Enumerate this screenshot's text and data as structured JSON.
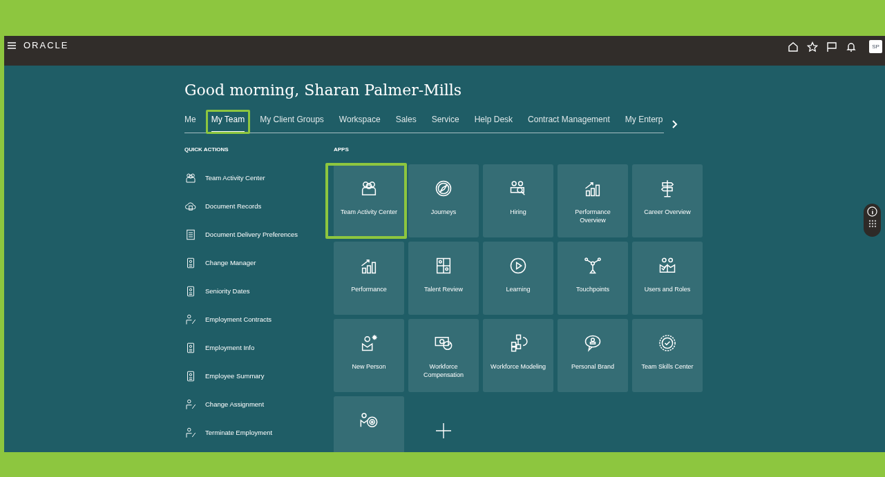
{
  "header": {
    "brand": "ORACLE",
    "avatar": "SP"
  },
  "greeting": "Good morning, Sharan Palmer-Mills",
  "tabs": [
    {
      "label": "Me",
      "selected": false,
      "highlighted": false
    },
    {
      "label": "My Team",
      "selected": true,
      "highlighted": true
    },
    {
      "label": "My Client Groups",
      "selected": false,
      "highlighted": false
    },
    {
      "label": "Workspace",
      "selected": false,
      "highlighted": false
    },
    {
      "label": "Sales",
      "selected": false,
      "highlighted": false
    },
    {
      "label": "Service",
      "selected": false,
      "highlighted": false
    },
    {
      "label": "Help Desk",
      "selected": false,
      "highlighted": false
    },
    {
      "label": "Contract Management",
      "selected": false,
      "highlighted": false
    },
    {
      "label": "My Enterp",
      "selected": false,
      "highlighted": false
    }
  ],
  "quick_actions": {
    "title": "QUICK ACTIONS",
    "items": [
      {
        "label": "Team Activity Center"
      },
      {
        "label": "Document Records"
      },
      {
        "label": "Document Delivery Preferences"
      },
      {
        "label": "Change Manager"
      },
      {
        "label": "Seniority Dates"
      },
      {
        "label": "Employment Contracts"
      },
      {
        "label": "Employment Info"
      },
      {
        "label": "Employee Summary"
      },
      {
        "label": "Change Assignment"
      },
      {
        "label": "Terminate Employment"
      }
    ]
  },
  "apps": {
    "title": "APPS",
    "tiles": [
      {
        "kind": "tile",
        "label": "Team Activity Center",
        "highlighted": true
      },
      {
        "kind": "tile",
        "label": "Journeys",
        "highlighted": false
      },
      {
        "kind": "tile",
        "label": "Hiring",
        "highlighted": false
      },
      {
        "kind": "tile",
        "label": "Performance Overview",
        "highlighted": false
      },
      {
        "kind": "tile",
        "label": "Career Overview",
        "highlighted": false
      },
      {
        "kind": "tile",
        "label": "Performance",
        "highlighted": false
      },
      {
        "kind": "tile",
        "label": "Talent Review",
        "highlighted": false
      },
      {
        "kind": "tile",
        "label": "Learning",
        "highlighted": false
      },
      {
        "kind": "tile",
        "label": "Touchpoints",
        "highlighted": false
      },
      {
        "kind": "tile",
        "label": "Users and Roles",
        "highlighted": false
      },
      {
        "kind": "tile",
        "label": "New Person",
        "highlighted": false
      },
      {
        "kind": "tile",
        "label": "Workforce Compensation",
        "highlighted": false
      },
      {
        "kind": "tile",
        "label": "Workforce Modeling",
        "highlighted": false
      },
      {
        "kind": "tile",
        "label": "Personal Brand",
        "highlighted": false
      },
      {
        "kind": "tile",
        "label": "Team Skills Center",
        "highlighted": false
      },
      {
        "kind": "tile",
        "highlighted": false
      },
      {
        "kind": "add"
      }
    ]
  }
}
